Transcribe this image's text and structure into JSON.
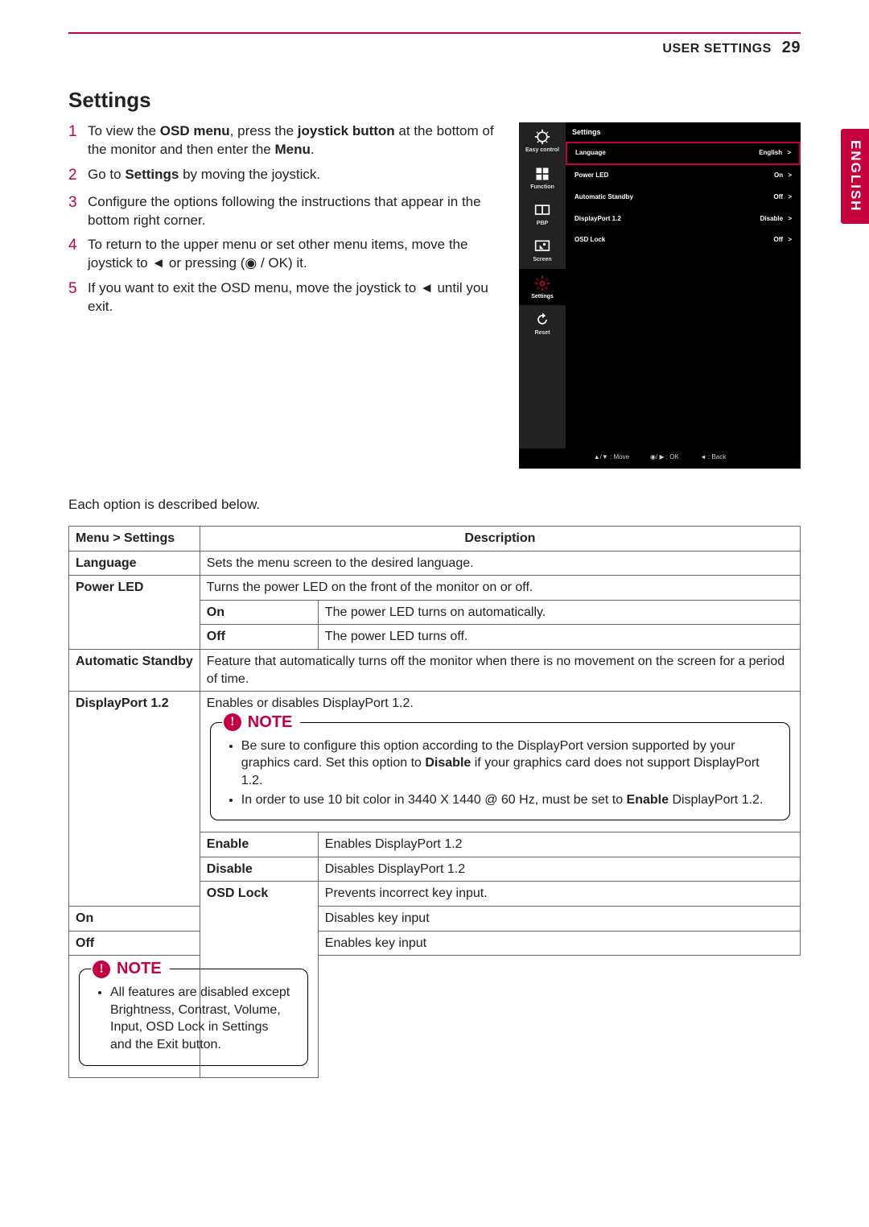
{
  "header": {
    "section": "USER SETTINGS",
    "page": "29",
    "lang_tab": "ENGLISH"
  },
  "title": "Settings",
  "steps": [
    {
      "n": "1",
      "pre": "To view the ",
      "b1": "OSD menu",
      "mid": ", press the ",
      "b2": "joystick button",
      "post": " at the bottom of the monitor and then enter the ",
      "b3": "Menu",
      "end": "."
    },
    {
      "n": "2",
      "pre": "Go to ",
      "b1": "Settings",
      "post": " by moving the joystick."
    },
    {
      "n": "3",
      "plain": "Configure the options following the instructions that appear in the bottom right corner."
    },
    {
      "n": "4",
      "plain": "To return to the upper menu or set other menu items, move the joystick to ◄ or pressing (◉ / OK) it."
    },
    {
      "n": "5",
      "plain": "If you want to exit the OSD menu, move the joystick to ◄ until you exit."
    }
  ],
  "osd": {
    "title": "Settings",
    "side": [
      {
        "id": "easy",
        "label": "Easy control"
      },
      {
        "id": "func",
        "label": "Function"
      },
      {
        "id": "pbp",
        "label": "PBP"
      },
      {
        "id": "screen",
        "label": "Screen"
      },
      {
        "id": "settings",
        "label": "Settings",
        "selected": true
      },
      {
        "id": "reset",
        "label": "Reset"
      }
    ],
    "rows": [
      {
        "label": "Language",
        "value": "English",
        "selected": true
      },
      {
        "label": "Power LED",
        "value": "On"
      },
      {
        "label": "Automatic Standby",
        "value": "Off"
      },
      {
        "label": "DisplayPort 1.2",
        "value": "Disable"
      },
      {
        "label": "OSD Lock",
        "value": "Off"
      }
    ],
    "footer": {
      "move": "▲/▼ : Move",
      "ok": "◉/ ▶ : OK",
      "back": "◄ : Back"
    }
  },
  "subhead": "Each option is described below.",
  "table": {
    "head": {
      "c1": "Menu > Settings",
      "c2": "Description"
    },
    "language": {
      "label": "Language",
      "desc": "Sets the menu screen to the desired language."
    },
    "powerled": {
      "label": "Power LED",
      "desc": "Turns the power LED on the front of the monitor on or off.",
      "on": {
        "k": "On",
        "v": "The power LED turns on automatically."
      },
      "off": {
        "k": "Off",
        "v": "The power LED turns off."
      }
    },
    "auto": {
      "label": "Automatic Standby",
      "desc": "Feature that automatically turns off the monitor when there is no movement on the screen for a period of time."
    },
    "dp": {
      "label": "DisplayPort 1.2",
      "desc": "Enables or disables DisplayPort 1.2.",
      "note_label": "NOTE",
      "note1_a": "Be sure to configure this option according to the DisplayPort version supported by your graphics card. Set this option to ",
      "note1_b": "Disable",
      "note1_c": " if your graphics card does not support DisplayPort 1.2.",
      "note2_a": "In order to use 10 bit color in 3440 X 1440 @ 60 Hz, must be set to ",
      "note2_b": "Enable",
      "note2_c": " DisplayPort 1.2.",
      "enable": {
        "k": "Enable",
        "v": "Enables DisplayPort 1.2"
      },
      "disable": {
        "k": "Disable",
        "v": "Disables DisplayPort 1.2"
      }
    },
    "osdlock": {
      "label": "OSD Lock",
      "desc": "Prevents incorrect key input.",
      "on": {
        "k": "On",
        "v": "Disables key input"
      },
      "off": {
        "k": "Off",
        "v": "Enables key input"
      },
      "note_label": "NOTE",
      "note": "All features are disabled except Brightness, Contrast, Volume, Input, OSD Lock in Settings and the Exit button."
    }
  }
}
